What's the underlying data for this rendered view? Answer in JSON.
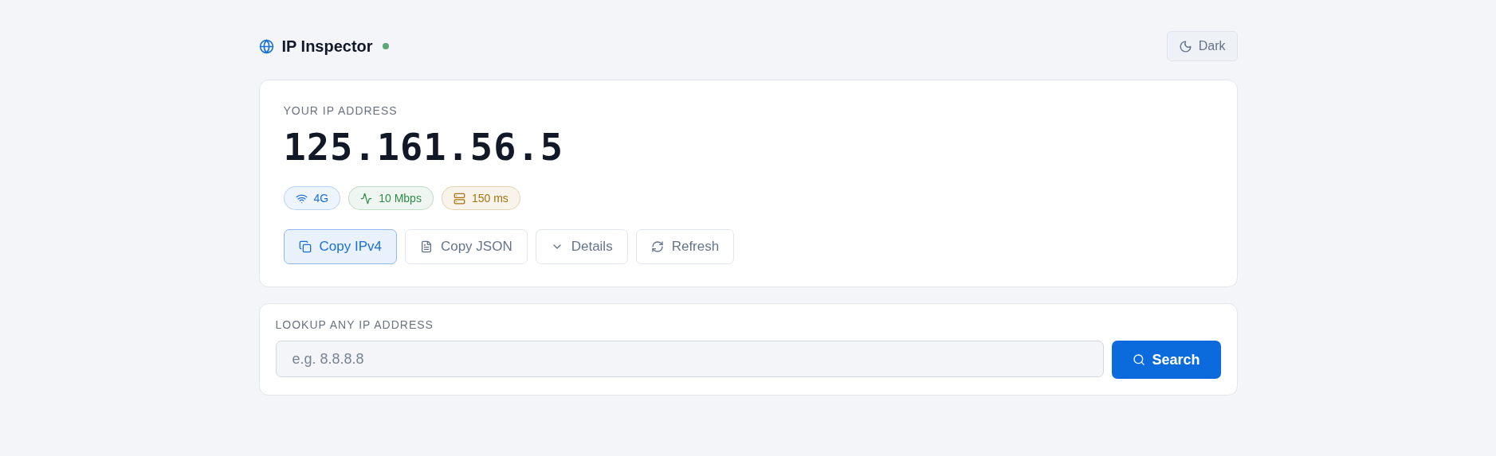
{
  "header": {
    "title": "IP Inspector",
    "online": true,
    "theme_button": "Dark"
  },
  "ip_card": {
    "label": "YOUR IP ADDRESS",
    "address": "125.161.56.5",
    "badges": [
      {
        "kind": "network",
        "text": "4G",
        "color": "#1a6fd8"
      },
      {
        "kind": "speed",
        "text": "10 Mbps",
        "color": "#2e8a4a"
      },
      {
        "kind": "latency",
        "text": "150 ms",
        "color": "#a8720c"
      }
    ],
    "actions": [
      {
        "kind": "copy",
        "label": "Copy IPv4",
        "active": true
      },
      {
        "kind": "file",
        "label": "Copy JSON",
        "active": false
      },
      {
        "kind": "details",
        "label": "Details",
        "active": false
      },
      {
        "kind": "refresh",
        "label": "Refresh",
        "active": false
      }
    ]
  },
  "lookup": {
    "label": "LOOKUP ANY IP ADDRESS",
    "placeholder": "e.g. 8.8.8.8",
    "button": "Search"
  }
}
